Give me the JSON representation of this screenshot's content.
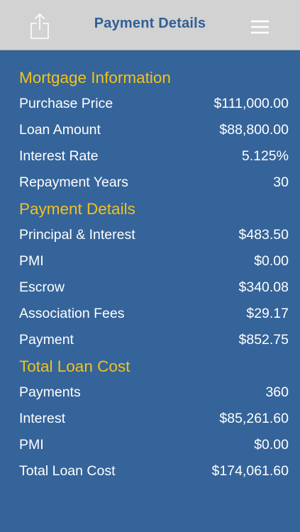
{
  "header": {
    "title": "Payment Details",
    "share_icon": "share-icon",
    "menu_icon": "hamburger-menu-icon"
  },
  "colors": {
    "background": "#35649a",
    "navbar": "#d2d2d2",
    "title": "#2f5f96",
    "section_header": "#f1c21b",
    "text": "#ffffff"
  },
  "sections": [
    {
      "title": "Mortgage Information",
      "rows": [
        {
          "label": "Purchase Price",
          "value": "$111,000.00"
        },
        {
          "label": "Loan Amount",
          "value": "$88,800.00"
        },
        {
          "label": "Interest Rate",
          "value": "5.125%"
        },
        {
          "label": "Repayment Years",
          "value": "30"
        }
      ]
    },
    {
      "title": "Payment Details",
      "rows": [
        {
          "label": "Principal & Interest",
          "value": "$483.50"
        },
        {
          "label": "PMI",
          "value": "$0.00"
        },
        {
          "label": "Escrow",
          "value": "$340.08"
        },
        {
          "label": "Association Fees",
          "value": "$29.17"
        },
        {
          "label": "Payment",
          "value": "$852.75"
        }
      ]
    },
    {
      "title": "Total Loan Cost",
      "rows": [
        {
          "label": "Payments",
          "value": "360"
        },
        {
          "label": "Interest",
          "value": "$85,261.60"
        },
        {
          "label": "PMI",
          "value": "$0.00"
        },
        {
          "label": "Total Loan Cost",
          "value": "$174,061.60"
        }
      ]
    }
  ]
}
